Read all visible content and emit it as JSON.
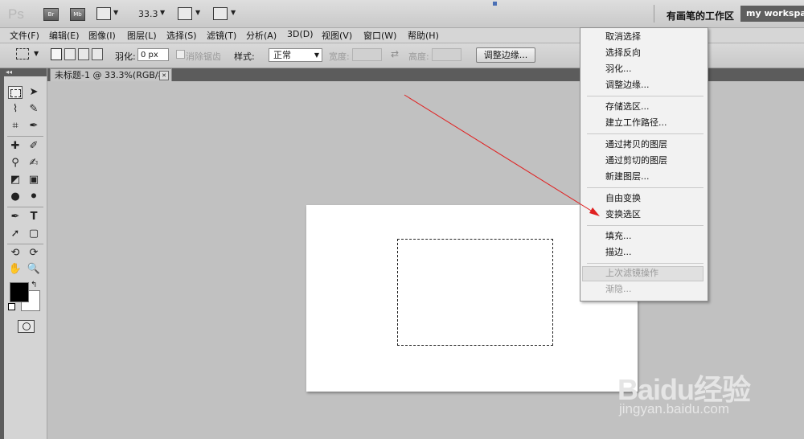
{
  "app": {
    "logo": "Ps",
    "buttons": {
      "bridge": "Br",
      "mini_bridge": "Mb"
    },
    "zoom": "33.3",
    "workspace_active": "有画笔的工作区",
    "workspace_name": "my workspac"
  },
  "menubar": {
    "items": [
      "文件(F)",
      "编辑(E)",
      "图像(I)",
      "图层(L)",
      "选择(S)",
      "滤镜(T)",
      "分析(A)",
      "3D(D)",
      "视图(V)",
      "窗口(W)",
      "帮助(H)"
    ]
  },
  "options": {
    "feather_label": "羽化:",
    "feather_value": "0 px",
    "antialias_label": "消除锯齿",
    "style_label": "样式:",
    "style_value": "正常",
    "width_label": "宽度:",
    "height_label": "高度:",
    "refine_edge_button": "调整边缘..."
  },
  "document": {
    "tab_title": "未标题-1 @ 33.3%(RGB/8)",
    "close_glyph": "✕"
  },
  "context_menu": {
    "groups": [
      [
        "取消选择",
        "选择反向",
        "羽化...",
        "调整边缘..."
      ],
      [
        "存储选区...",
        "建立工作路径..."
      ],
      [
        "通过拷贝的图层",
        "通过剪切的图层",
        "新建图层..."
      ],
      [
        "自由变换",
        "变换选区"
      ],
      [
        "填充...",
        "描边..."
      ],
      [
        "上次滤镜操作",
        "渐隐..."
      ]
    ],
    "disabled": [
      "上次滤镜操作",
      "渐隐..."
    ]
  },
  "annotation": {
    "arrow_color": "#e02020"
  },
  "watermark": {
    "logo": "Baidu经验",
    "url": "jingyan.baidu.com"
  },
  "colors": {
    "foreground": "#000000",
    "background": "#ffffff"
  }
}
